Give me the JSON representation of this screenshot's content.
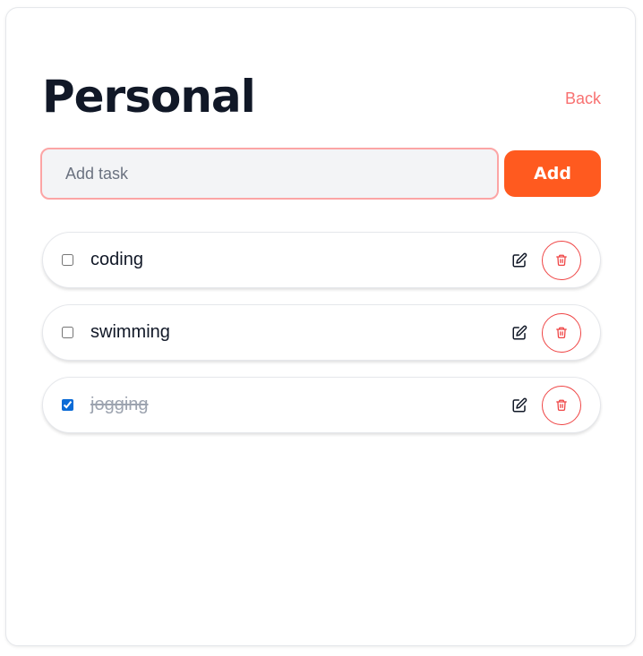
{
  "page": {
    "title": "Personal",
    "back_label": "Back"
  },
  "add_task": {
    "placeholder": "Add task",
    "value": "",
    "button_label": "Add"
  },
  "tasks": [
    {
      "label": "coding",
      "completed": false
    },
    {
      "label": "swimming",
      "completed": false
    },
    {
      "label": "jogging",
      "completed": true
    }
  ],
  "icons": {
    "edit": "pencil-square-icon",
    "delete": "trash-icon"
  },
  "colors": {
    "accent": "#ff5a1f",
    "back_link": "#f87171",
    "delete": "#ef4444",
    "input_border": "#fca5a5",
    "checkbox": "#0b6bd6"
  }
}
